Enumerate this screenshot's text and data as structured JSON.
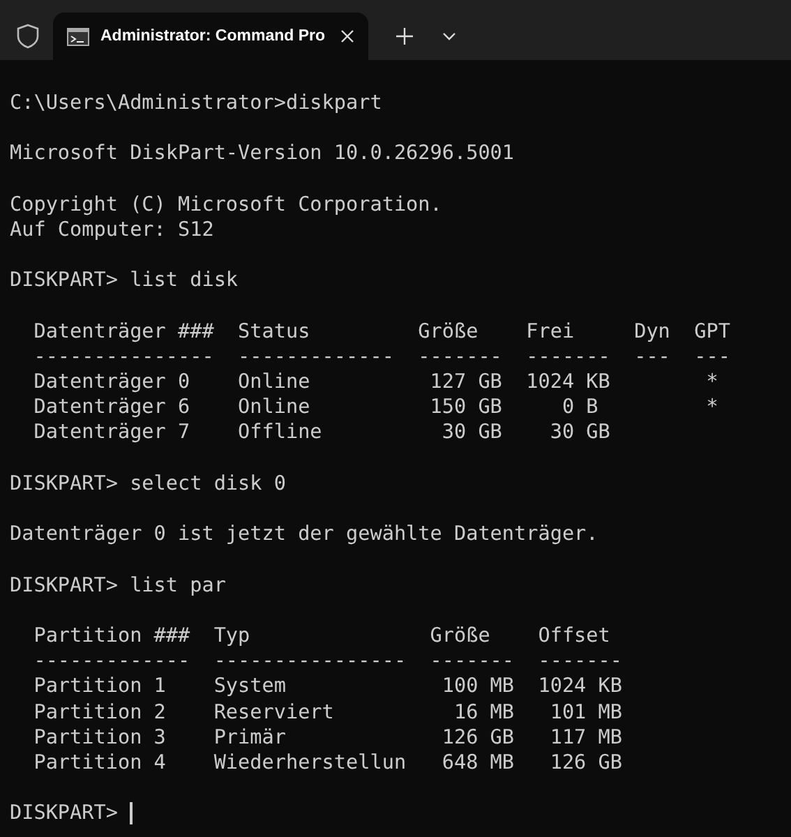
{
  "tab_bar": {
    "tab": {
      "title": "Administrator: Command Pro"
    }
  },
  "terminal": {
    "blocks": [
      {
        "kind": "text",
        "lines": [
          "C:\\Users\\Administrator>diskpart"
        ]
      },
      {
        "kind": "text",
        "lines": [
          "Microsoft DiskPart-Version 10.0.26296.5001"
        ]
      },
      {
        "kind": "text",
        "lines": [
          "Copyright (C) Microsoft Corporation.",
          "Auf Computer: S12"
        ]
      },
      {
        "kind": "text",
        "lines": [
          "DISKPART> list disk"
        ]
      },
      {
        "kind": "text",
        "lines": [
          "  Datenträger ###  Status         Größe    Frei     Dyn  GPT",
          "  ---------------  -------------  -------  -------  ---  ---",
          "  Datenträger 0    Online          127 GB  1024 KB        *",
          "  Datenträger 6    Online          150 GB     0 B         *",
          "  Datenträger 7    Offline          30 GB    30 GB"
        ]
      },
      {
        "kind": "text",
        "lines": [
          "DISKPART> select disk 0"
        ]
      },
      {
        "kind": "text",
        "lines": [
          "Datenträger 0 ist jetzt der gewählte Datenträger."
        ]
      },
      {
        "kind": "text",
        "lines": [
          "DISKPART> list par"
        ]
      },
      {
        "kind": "text",
        "lines": [
          "  Partition ###  Typ               Größe    Offset",
          "  -------------  ----------------  -------  -------",
          "  Partition 1    System             100 MB  1024 KB",
          "  Partition 2    Reserviert          16 MB   101 MB",
          "  Partition 3    Primär             126 GB   117 MB",
          "  Partition 4    Wiederherstellun   648 MB   126 GB"
        ]
      },
      {
        "kind": "prompt",
        "lines": [
          "DISKPART> "
        ]
      }
    ]
  }
}
